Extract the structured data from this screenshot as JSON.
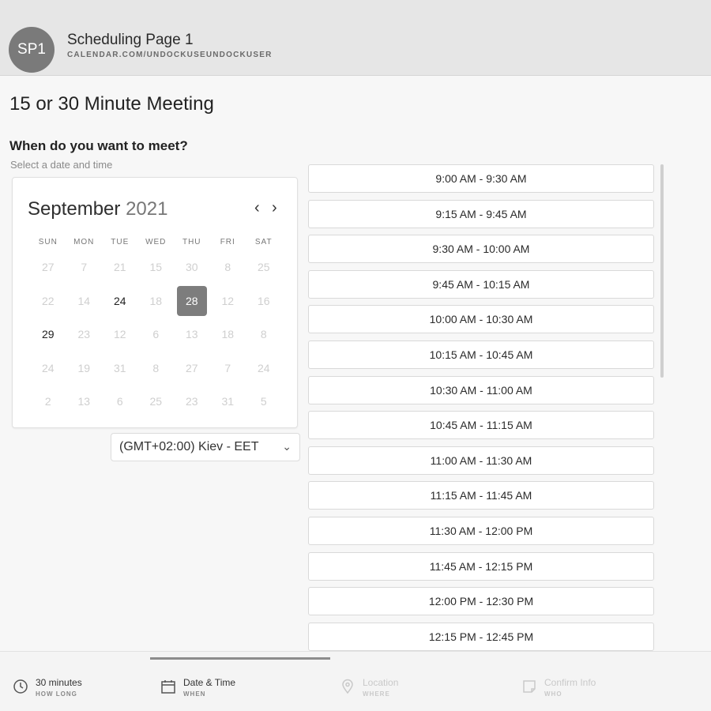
{
  "header": {
    "avatar_initials": "SP1",
    "page_name": "Scheduling Page 1",
    "page_url": "CALENDAR.COM/UNDOCKUSEUNDOCKUSER"
  },
  "main": {
    "meeting_title": "15 or 30 Minute Meeting",
    "question": "When do you want to meet?",
    "subtitle": "Select a date and time"
  },
  "calendar": {
    "month": "September",
    "year": "2021",
    "weekdays": [
      "SUN",
      "MON",
      "TUE",
      "WED",
      "THU",
      "FRI",
      "SAT"
    ],
    "weeks": [
      [
        "27",
        "7",
        "21",
        "15",
        "30",
        "8",
        "25"
      ],
      [
        "22",
        "14",
        "24",
        "18",
        "28",
        "12",
        "16"
      ],
      [
        "29",
        "23",
        "12",
        "6",
        "13",
        "18",
        "8"
      ],
      [
        "24",
        "19",
        "31",
        "8",
        "27",
        "7",
        "24"
      ],
      [
        "2",
        "13",
        "6",
        "25",
        "23",
        "31",
        "5"
      ]
    ],
    "available_days": [
      "24",
      "28",
      "29"
    ],
    "selected_day": "28",
    "prev_icon": "chevron-left-icon",
    "next_icon": "chevron-right-icon"
  },
  "timezone": {
    "value": "(GMT+02:00) Kiev - EET"
  },
  "time_slots": [
    "9:00 AM - 9:30 AM",
    "9:15 AM - 9:45 AM",
    "9:30 AM - 10:00 AM",
    "9:45 AM - 10:15 AM",
    "10:00 AM - 10:30 AM",
    "10:15 AM - 10:45 AM",
    "10:30 AM - 11:00 AM",
    "10:45 AM - 11:15 AM",
    "11:00 AM - 11:30 AM",
    "11:15 AM - 11:45 AM",
    "11:30 AM - 12:00 PM",
    "11:45 AM - 12:15 PM",
    "12:00 PM - 12:30 PM",
    "12:15 PM - 12:45 PM"
  ],
  "footer": {
    "steps": [
      {
        "label": "30 minutes",
        "sub": "HOW LONG",
        "icon": "clock-icon"
      },
      {
        "label": "Date & Time",
        "sub": "WHEN",
        "icon": "calendar-icon"
      },
      {
        "label": "Location",
        "sub": "WHERE",
        "icon": "location-pin-icon"
      },
      {
        "label": "Confirm Info",
        "sub": "WHO",
        "icon": "note-icon"
      }
    ]
  },
  "colors": {
    "selected_day_bg": "#7d7d7d",
    "topbar_bg": "#e6e6e6",
    "avatar_bg": "#7a7a7a"
  }
}
